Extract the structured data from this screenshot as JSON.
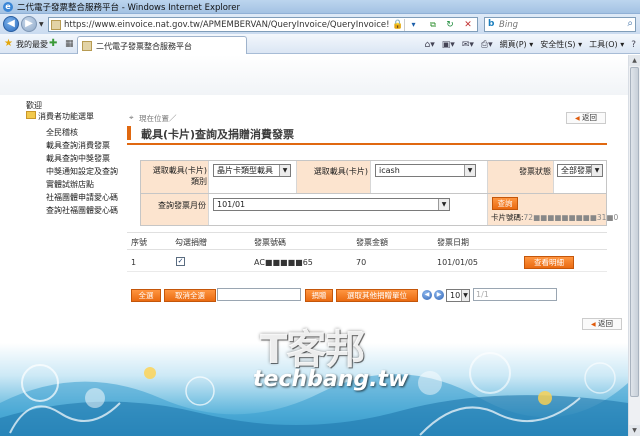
{
  "window": {
    "title": "二代電子發票整合服務平台 - Windows Internet Explorer"
  },
  "address": {
    "url": "https://www.einvoice.nat.gov.tw/APMEMBERVAN/QueryInvoice/QueryInvoice!queryInv",
    "search_placeholder": "Bing"
  },
  "favorites": {
    "label": "我的最愛"
  },
  "tab": {
    "title": "二代電子發票整合服務平台"
  },
  "toolbar": {
    "page_label": "網頁(P) ▾",
    "safety_label": "安全性(S) ▾",
    "tools_label": "工具(O) ▾",
    "help_icon": "?"
  },
  "sidebar": {
    "welcome": "歡迎",
    "menu_head": "消費者功能選單",
    "items": [
      "全民稽核",
      "載具查詢消費發票",
      "載具查詢中獎發票",
      "中獎通知設定及查詢",
      "實體試辦店點",
      "社福團體申請愛心碼",
      "查詢社福團體愛心碼"
    ]
  },
  "main": {
    "breadcrumb": "現在位置／",
    "back_label": "返回",
    "title": "載具(卡片)查詢及捐贈消費發票",
    "form": {
      "carrier_type_label": "選取載具(卡片)類別",
      "carrier_type_value": "晶片卡類型載具",
      "carrier_label": "選取載具(卡片)",
      "carrier_value": "icash",
      "status_label": "發票狀態",
      "status_value": "全部發票",
      "month_label": "查詢發票月份",
      "month_value": "101/01",
      "query_button": "查詢",
      "card_no_label": "卡片號碼:",
      "card_no_value": "72■■■■■■■■■31■0"
    },
    "table": {
      "headers": [
        "序號",
        "勾選捐贈",
        "發票號碼",
        "發票金額",
        "發票日期",
        ""
      ],
      "rows": [
        {
          "no": "1",
          "checked": true,
          "invoice_no": "AC■■■■■65",
          "amount": "70",
          "date": "101/01/05",
          "detail_button": "查看明細"
        }
      ]
    },
    "actions": {
      "select_all": "全選",
      "clear_all": "取消全選",
      "donate": "捐贈",
      "choose_unit": "選取其他捐贈單位",
      "page_size": "10",
      "page_indicator": "1/1"
    }
  },
  "watermark": {
    "main": "T客邦",
    "sub": "techbang.tw"
  },
  "colors": {
    "accent": "#e06810",
    "label_bg": "#fce4cf"
  }
}
